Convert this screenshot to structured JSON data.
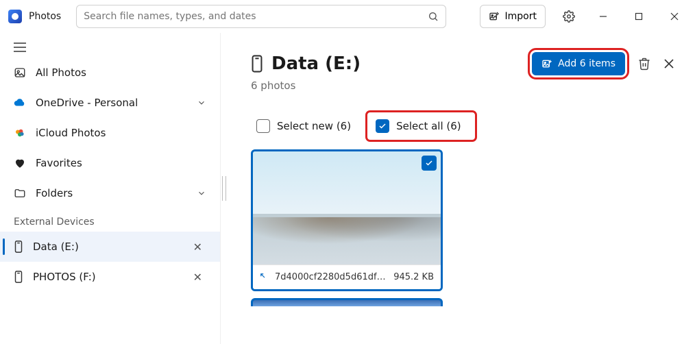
{
  "app": {
    "title": "Photos"
  },
  "search": {
    "placeholder": "Search file names, types, and dates"
  },
  "titlebar": {
    "import_label": "Import"
  },
  "sidebar": {
    "all_photos": "All Photos",
    "onedrive": "OneDrive - Personal",
    "icloud": "iCloud Photos",
    "favorites": "Favorites",
    "folders": "Folders",
    "section_external": "External Devices",
    "ext_data": "Data (E:)",
    "ext_photos": "PHOTOS (F:)"
  },
  "main": {
    "title": "Data (E:)",
    "subtitle": "6 photos",
    "add_button": "Add 6 items",
    "select_new": "Select new (6)",
    "select_all": "Select all (6)",
    "card0": {
      "filename": "7d4000cf2280d5d61df26c6ab558...",
      "size": "945.2 KB"
    }
  },
  "colors": {
    "accent": "#0067c0",
    "highlight_box": "#d22"
  }
}
